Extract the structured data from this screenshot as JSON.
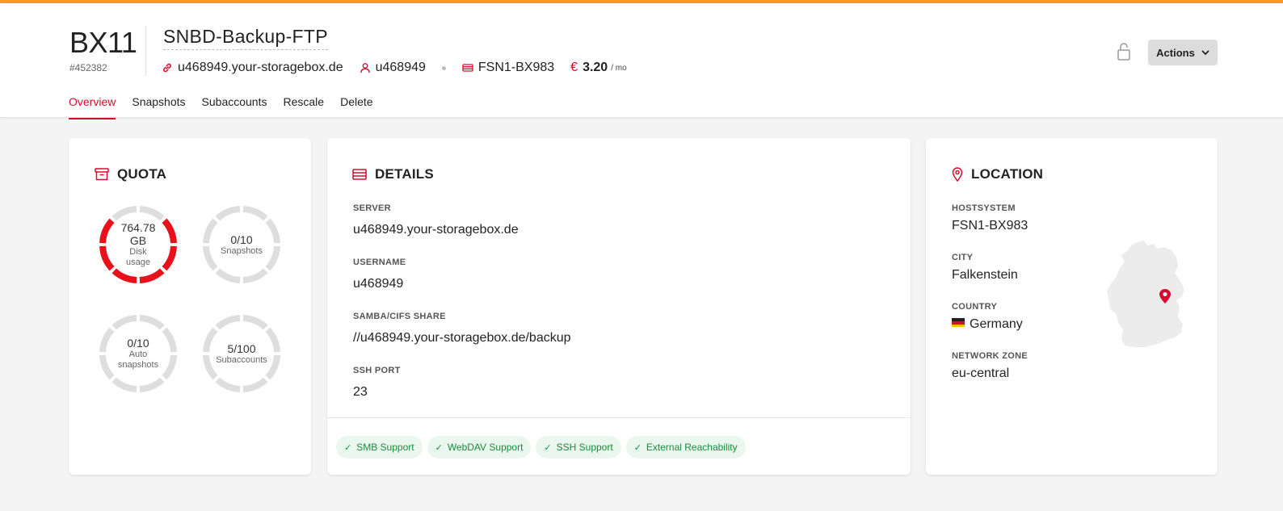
{
  "header": {
    "box_id": "BX11",
    "box_number": "#452382",
    "box_name": "SNBD-Backup-FTP",
    "hostname": "u468949.your-storagebox.de",
    "username": "u468949",
    "server": "FSN1-BX983",
    "currency": "€",
    "price": "3.20",
    "price_period": "/ mo",
    "actions_label": "Actions"
  },
  "tabs": [
    {
      "label": "Overview",
      "active": true
    },
    {
      "label": "Snapshots",
      "active": false
    },
    {
      "label": "Subaccounts",
      "active": false
    },
    {
      "label": "Rescale",
      "active": false
    },
    {
      "label": "Delete",
      "active": false
    }
  ],
  "quota": {
    "title": "QUOTA",
    "rings": [
      {
        "value": "764.78",
        "value2": "GB",
        "label": "Disk",
        "label2": "usage",
        "fraction": 0.75
      },
      {
        "value": "0/10",
        "label": "Snapshots",
        "fraction": 0
      },
      {
        "value": "0/10",
        "label": "Auto",
        "label2": "snapshots",
        "fraction": 0
      },
      {
        "value": "5/100",
        "label": "Subaccounts",
        "fraction": 0.05
      }
    ]
  },
  "details": {
    "title": "DETAILS",
    "server_label": "SERVER",
    "server_value": "u468949.your-storagebox.de",
    "username_label": "USERNAME",
    "username_value": "u468949",
    "samba_label": "SAMBA/CIFS SHARE",
    "samba_value": "//u468949.your-storagebox.de/backup",
    "ssh_label": "SSH PORT",
    "ssh_value": "23",
    "badges": [
      "SMB Support",
      "WebDAV Support",
      "SSH Support",
      "External Reachability"
    ]
  },
  "location": {
    "title": "LOCATION",
    "hostsystem_label": "HOSTSYSTEM",
    "hostsystem_value": "FSN1-BX983",
    "city_label": "CITY",
    "city_value": "Falkenstein",
    "country_label": "COUNTRY",
    "country_value": "Germany",
    "zone_label": "NETWORK ZONE",
    "zone_value": "eu-central"
  },
  "colors": {
    "accent": "#d50c2d",
    "topbar": "#f39c1f",
    "ring_used": "#e8101a",
    "ring_track": "#dedede",
    "badge_green": "#1a8a3a"
  }
}
